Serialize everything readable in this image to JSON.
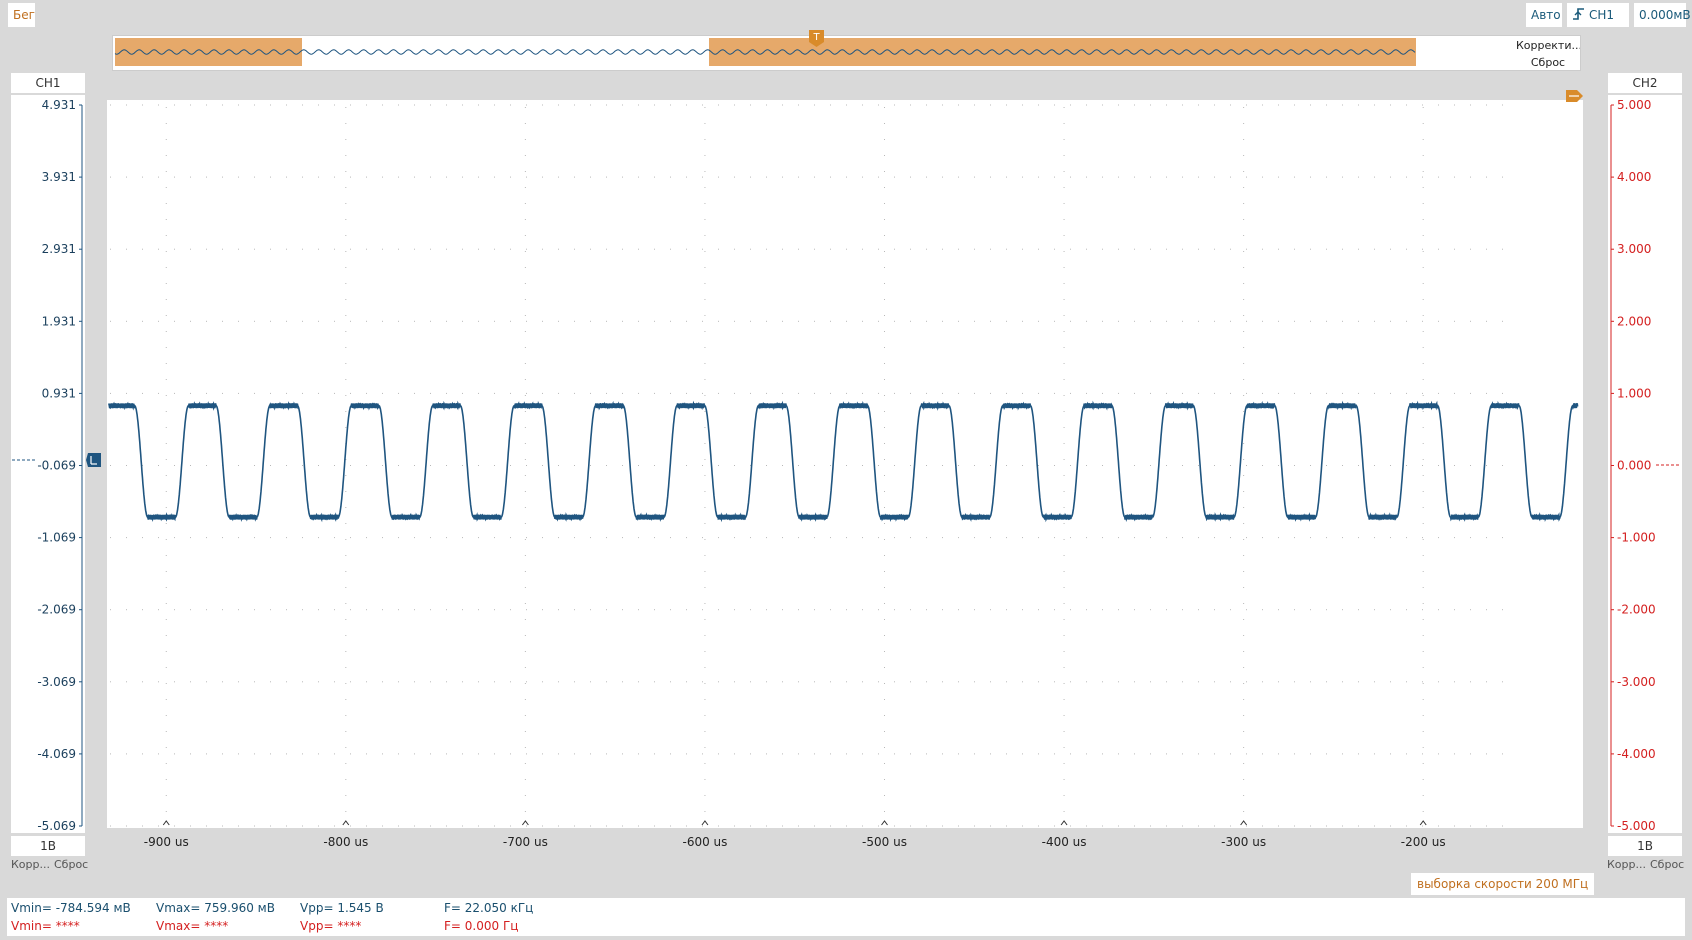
{
  "toolbar": {
    "status": "Бег",
    "mode": "Авто",
    "trigger_source": "CH1",
    "trigger_level": "0.000мВ"
  },
  "overview": {
    "correction_label": "Корректи...",
    "reset_label": "Сброс",
    "trigger_marker": "T"
  },
  "ch1": {
    "name": "CH1",
    "scale": "1В",
    "correct_label": "Корр...",
    "reset_label": "Сброс",
    "color": "#1f5580"
  },
  "ch2": {
    "name": "CH2",
    "scale": "1В",
    "correct_label": "Корр...",
    "reset_label": "Сброс",
    "color": "#d42020"
  },
  "chart_data": {
    "type": "line",
    "x_ticks": [
      "-900 us",
      "-800 us",
      "-700 us",
      "-600 us",
      "-500 us",
      "-400 us",
      "-300 us",
      "-200 us"
    ],
    "x_tick_values": [
      -900,
      -800,
      -700,
      -600,
      -500,
      -400,
      -300,
      -200
    ],
    "xlim": [
      -933,
      -111
    ],
    "left_axis": {
      "ticks": [
        "4.931",
        "3.931",
        "2.931",
        "1.931",
        "0.931",
        "-0.069",
        "-1.069",
        "-2.069",
        "-3.069",
        "-4.069",
        "-5.069"
      ],
      "ylim": [
        -5.069,
        4.931
      ],
      "color": "#1f5580"
    },
    "right_axis": {
      "ticks": [
        "5.000",
        "4.000",
        "3.000",
        "2.000",
        "1.000",
        "0.000",
        "-1.000",
        "-2.000",
        "-3.000",
        "-4.000",
        "-5.000"
      ],
      "ylim": [
        -5.0,
        5.0
      ],
      "color": "#d42020"
    },
    "grid": true,
    "series": [
      {
        "channel": "CH1",
        "color": "#1f5580",
        "waveform": "square-like",
        "frequency_khz": 22.05,
        "period_us": 45.35,
        "vmax_v": 0.76,
        "vmin_v": -0.785
      }
    ]
  },
  "sample_rate": "выборка скорости 200 МГц",
  "measurements": {
    "ch1": {
      "vmin": "Vmin= -784.594 мВ",
      "vmax": "Vmax= 759.960 мВ",
      "vpp": "Vpp= 1.545 В",
      "freq": "F= 22.050 кГц"
    },
    "ch2": {
      "vmin": "Vmin= ****",
      "vmax": "Vmax= ****",
      "vpp": "Vpp= ****",
      "freq": "F= 0.000 Гц"
    }
  }
}
